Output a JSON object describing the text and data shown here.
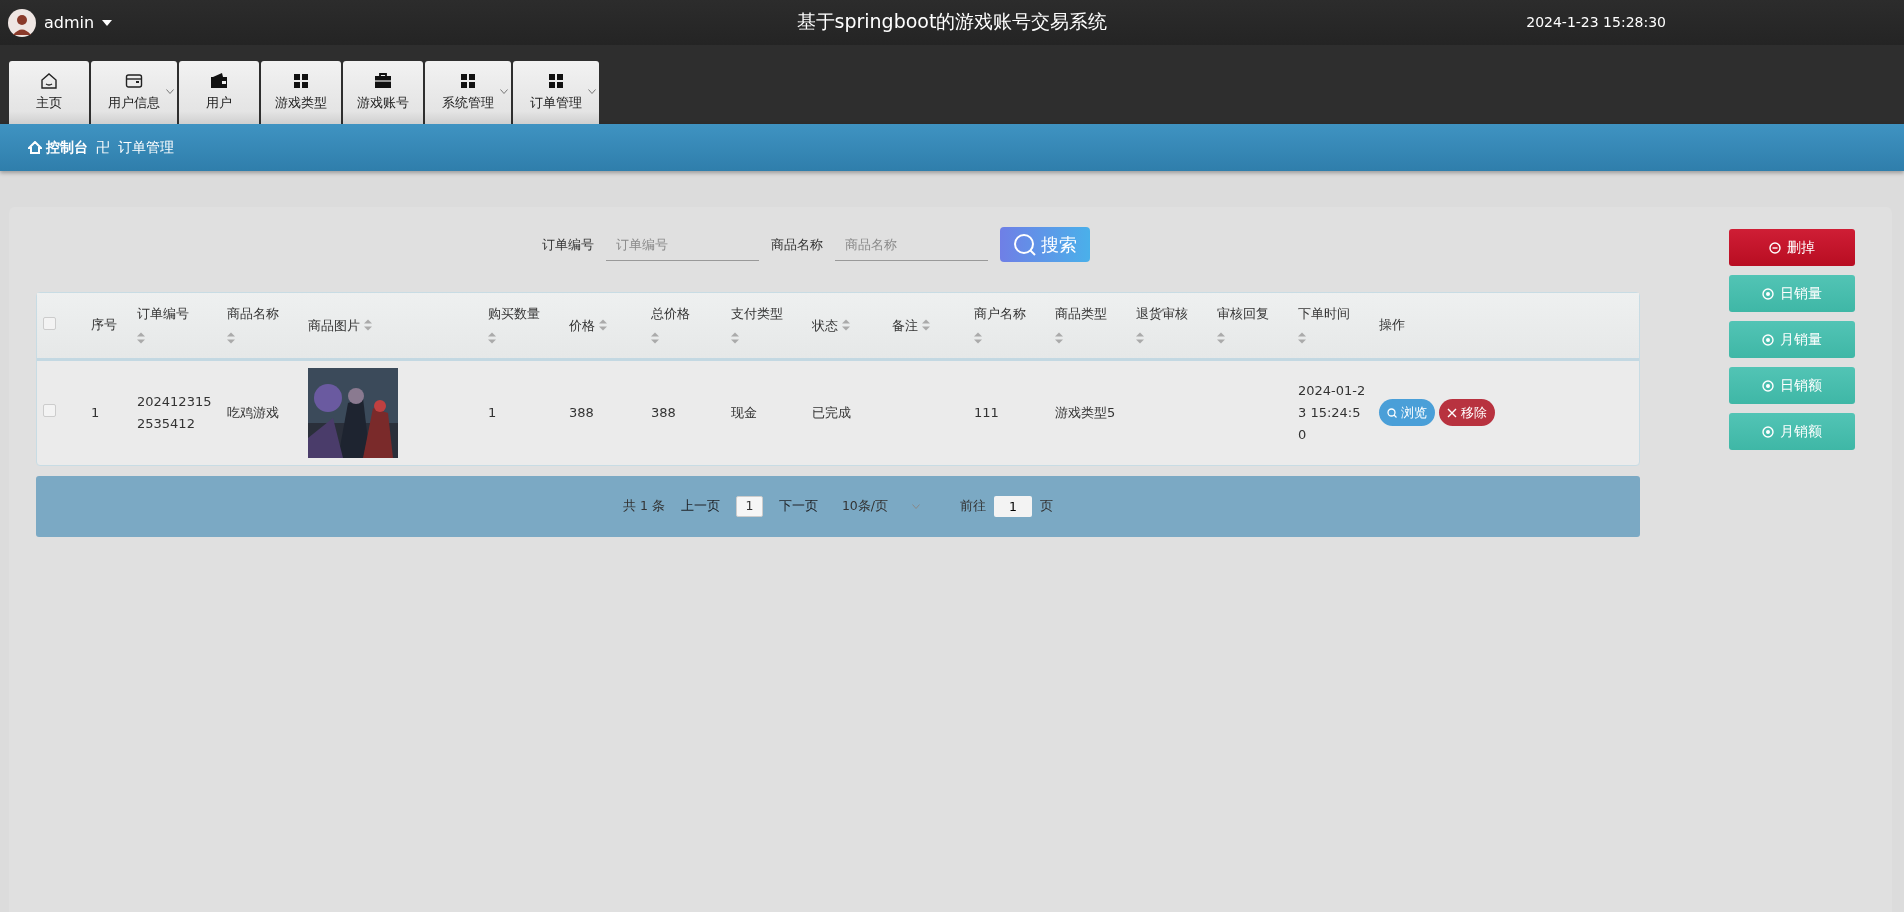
{
  "header": {
    "user": "admin",
    "title": "基于springboot的游戏账号交易系统",
    "datetime": "2024-1-23 15:28:30"
  },
  "nav": [
    {
      "label": "主页",
      "dropdown": false
    },
    {
      "label": "用户信息",
      "dropdown": true
    },
    {
      "label": "用户",
      "dropdown": false
    },
    {
      "label": "游戏类型",
      "dropdown": false
    },
    {
      "label": "游戏账号",
      "dropdown": false
    },
    {
      "label": "系统管理",
      "dropdown": true
    },
    {
      "label": "订单管理",
      "dropdown": true
    }
  ],
  "breadcrumb": {
    "home": "控制台",
    "separator": "卍",
    "current": "订单管理"
  },
  "search": {
    "fields": [
      {
        "label": "订单编号",
        "placeholder": "订单编号"
      },
      {
        "label": "商品名称",
        "placeholder": "商品名称"
      }
    ],
    "button": "搜索"
  },
  "side_buttons": [
    {
      "label": "删掉",
      "kind": "danger"
    },
    {
      "label": "日销量",
      "kind": "stat"
    },
    {
      "label": "月销量",
      "kind": "stat"
    },
    {
      "label": "日销额",
      "kind": "stat"
    },
    {
      "label": "月销额",
      "kind": "stat"
    }
  ],
  "table": {
    "select_all": {
      "checked": false
    },
    "columns": [
      {
        "label": "序号"
      },
      {
        "label": "订单编号"
      },
      {
        "label": "商品名称"
      },
      {
        "label": "商品图片"
      },
      {
        "label": "购买数量"
      },
      {
        "label": "价格"
      },
      {
        "label": "总价格"
      },
      {
        "label": "支付类型"
      },
      {
        "label": "状态"
      },
      {
        "label": "备注"
      },
      {
        "label": "商户名称"
      },
      {
        "label": "商品类型"
      },
      {
        "label": "退货审核"
      },
      {
        "label": "审核回复"
      },
      {
        "label": "下单时间"
      },
      {
        "label": "操作"
      }
    ],
    "rows": [
      {
        "checked": false,
        "cells": [
          {
            "kind": "text",
            "text": "1"
          },
          {
            "kind": "text",
            "text": "2024123152535412"
          },
          {
            "kind": "text",
            "text": "吃鸡游戏"
          },
          {
            "kind": "picture"
          },
          {
            "kind": "text",
            "text": "1"
          },
          {
            "kind": "text",
            "text": "388"
          },
          {
            "kind": "text",
            "text": "388"
          },
          {
            "kind": "text",
            "text": "现金"
          },
          {
            "kind": "text",
            "text": "已完成"
          },
          {
            "kind": "empty"
          },
          {
            "kind": "text",
            "text": "111"
          },
          {
            "kind": "text",
            "text": "游戏类型5"
          },
          {
            "kind": "empty"
          },
          {
            "kind": "empty"
          },
          {
            "kind": "text",
            "text": "2024-01-23 15:24:50"
          }
        ],
        "actions": [
          {
            "label": "浏览",
            "kind": "view"
          },
          {
            "label": "移除",
            "kind": "remove"
          }
        ]
      }
    ]
  },
  "pagination": {
    "total": "共 1 条",
    "prev": "上一页",
    "pages": [
      {
        "label": "1",
        "selected": true
      }
    ],
    "next": "下一页",
    "page_size": "10条/页",
    "goto_label": "前往",
    "goto_value": "1",
    "goto_suffix": "页"
  }
}
